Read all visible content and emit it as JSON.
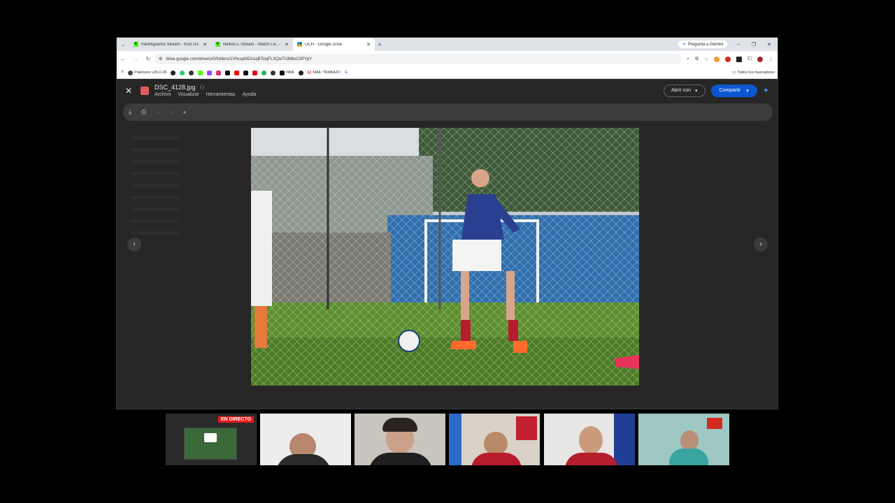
{
  "browser": {
    "tabs": [
      {
        "title": "frankfiguerce Stream - Kick Do",
        "favicon": "kick-icon"
      },
      {
        "title": "NeltorCL Stream - Watch Live o",
        "favicon": "kick-icon"
      },
      {
        "title": "UCH - Google Drive",
        "favicon": "drive-icon",
        "active": true
      }
    ],
    "gemini_label": "Pregunta a Gemini",
    "url": "drive.google.com/drive/u/0/folders/1VhcspMZA1qBTsiqFLSQwTI1M8oC0PYpY",
    "bookmarks": [
      "Paletooro v26.0.28",
      "NBA",
      "MAIL TRABAJO"
    ],
    "bookmarks_all": "Todos los marcadores"
  },
  "viewer": {
    "file_name": "DSC_4128.jpg",
    "menu": [
      "Archivo",
      "Visualizar",
      "Herramientas",
      "Ayuda"
    ],
    "open_with_label": "Abrir con",
    "share_label": "Compartir"
  },
  "webcams": {
    "live_badge": "EN DIRECTO"
  },
  "colors": {
    "share_blue": "#0b57d0",
    "viewer_bg": "#262626",
    "live_red": "#e91916"
  }
}
